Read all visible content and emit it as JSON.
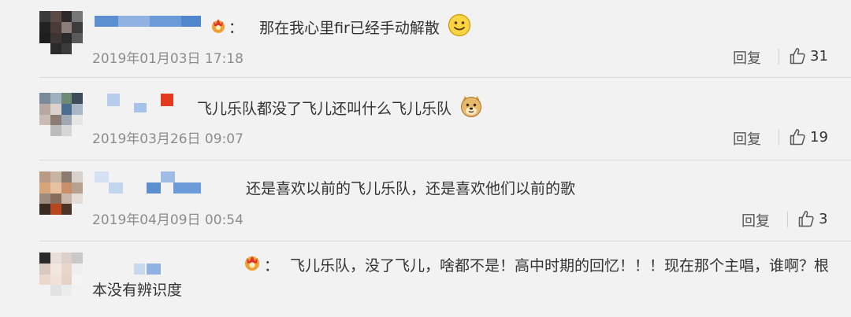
{
  "comments": [
    {
      "text": "那在我心里fir已经手动解散",
      "colon": "：",
      "emoji": "smile-emoji",
      "date": "2019年01月03日 17:18",
      "reply_label": "回复",
      "likes": "31"
    },
    {
      "text": "飞儿乐队都没了飞儿还叫什么飞儿乐队",
      "emoji": "doge-emoji",
      "date": "2019年03月26日 09:07",
      "reply_label": "回复",
      "likes": "19"
    },
    {
      "text": "还是喜欢以前的飞儿乐队，还是喜欢他们以前的歌",
      "date": "2019年04月09日 00:54",
      "reply_label": "回复",
      "likes": "3"
    },
    {
      "text": "飞儿乐队，没了飞儿，啥都不是！高中时期的回忆！！！现在那个主唱，谁啊？根本没有辨识度",
      "colon": "："
    }
  ],
  "icons": {
    "like": "thumbs-up-icon",
    "badge": "crown-badge-icon"
  },
  "colors": {
    "background": "#f2f2f2",
    "username_blur": "#5b9bd5",
    "date": "#8c8c8c"
  }
}
